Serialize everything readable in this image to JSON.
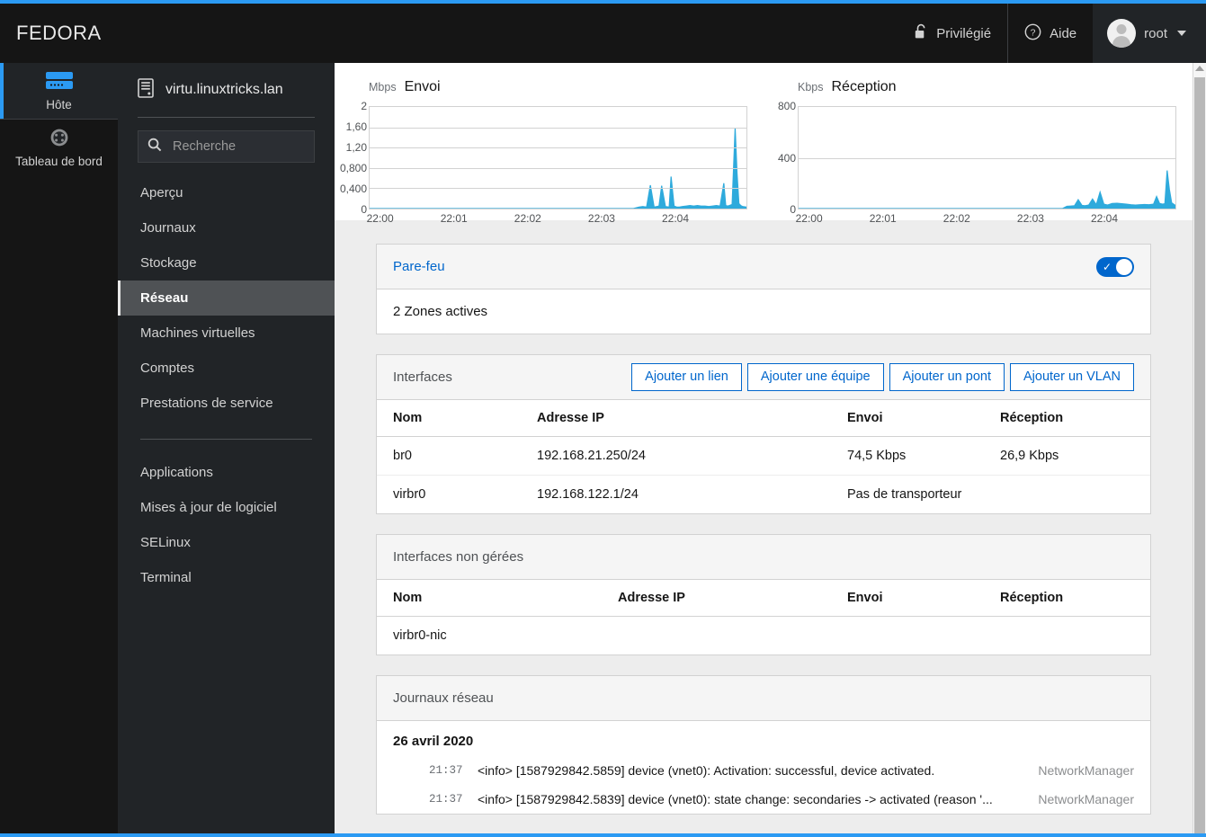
{
  "header": {
    "brand": "FEDORA",
    "privileged_label": "Privilégié",
    "privileged_icon": "unlock-icon",
    "help_label": "Aide",
    "help_icon": "help-circle-icon",
    "user_label": "root",
    "user_icon": "avatar-icon",
    "caret_icon": "chevron-down-icon",
    "accent_color": "#2b9af3"
  },
  "rail": {
    "items": [
      {
        "label": "Hôte",
        "icon": "server-icon",
        "active": true
      },
      {
        "label": "Tableau de bord",
        "icon": "dashboard-gauge-icon",
        "active": false
      }
    ]
  },
  "sidebar": {
    "hostname": "virtu.linuxtricks.lan",
    "hostname_icon": "tower-server-icon",
    "search": {
      "placeholder": "Recherche",
      "value": "",
      "icon": "search-icon"
    },
    "items": [
      {
        "label": "Aperçu",
        "active": false
      },
      {
        "label": "Journaux",
        "active": false
      },
      {
        "label": "Stockage",
        "active": false
      },
      {
        "label": "Réseau",
        "active": true
      },
      {
        "label": "Machines virtuelles",
        "active": false
      },
      {
        "label": "Comptes",
        "active": false
      },
      {
        "label": "Prestations de service",
        "active": false
      }
    ],
    "items2": [
      {
        "label": "Applications",
        "active": false
      },
      {
        "label": "Mises à jour de logiciel",
        "active": false
      },
      {
        "label": "SELinux",
        "active": false
      },
      {
        "label": "Terminal",
        "active": false
      }
    ]
  },
  "chart_data": [
    {
      "type": "area",
      "title": "Envoi",
      "ylabel": "Mbps",
      "xlabel": "",
      "unit": "Mbps",
      "ylim": [
        0,
        2
      ],
      "yticks": [
        "0",
        "0,400",
        "0,800",
        "1,20",
        "1,60",
        "2"
      ],
      "ytick_values": [
        0,
        0.4,
        0.8,
        1.2,
        1.6,
        2
      ],
      "xticks": [
        "22:00",
        "22:01",
        "22:02",
        "22:03",
        "22:04"
      ],
      "grid": true,
      "legend": "none",
      "color": "#2eaadc",
      "x": [
        0.0,
        0.7,
        0.715,
        0.725,
        0.735,
        0.745,
        0.755,
        0.762,
        0.768,
        0.775,
        0.785,
        0.795,
        0.8,
        0.808,
        0.815,
        0.822,
        0.83,
        0.84,
        0.85,
        0.86,
        0.87,
        0.88,
        0.89,
        0.9,
        0.91,
        0.92,
        0.93,
        0.94,
        0.945,
        0.95,
        0.955,
        0.962,
        0.97,
        0.975,
        0.98,
        0.985,
        0.99,
        1.0
      ],
      "values": [
        0,
        0,
        0.03,
        0.04,
        0.03,
        0.46,
        0.03,
        0.04,
        0.05,
        0.45,
        0.04,
        0.03,
        0.63,
        0.05,
        0.03,
        0.03,
        0.04,
        0.05,
        0.06,
        0.05,
        0.06,
        0.05,
        0.05,
        0.04,
        0.05,
        0.06,
        0.05,
        0.5,
        0.06,
        0.05,
        0.06,
        0.08,
        1.59,
        0.7,
        0.1,
        0.06,
        0.04,
        0.03
      ]
    },
    {
      "type": "area",
      "title": "Réception",
      "ylabel": "Kbps",
      "xlabel": "",
      "unit": "Kbps",
      "ylim": [
        0,
        800
      ],
      "yticks": [
        "0",
        "400",
        "800"
      ],
      "ytick_values": [
        0,
        400,
        800
      ],
      "xticks": [
        "22:00",
        "22:01",
        "22:02",
        "22:03",
        "22:04"
      ],
      "grid": true,
      "legend": "none",
      "color": "#2eaadc",
      "x": [
        0.0,
        0.7,
        0.712,
        0.722,
        0.732,
        0.742,
        0.752,
        0.76,
        0.77,
        0.78,
        0.79,
        0.8,
        0.81,
        0.82,
        0.832,
        0.845,
        0.858,
        0.87,
        0.882,
        0.894,
        0.906,
        0.918,
        0.93,
        0.942,
        0.95,
        0.958,
        0.966,
        0.972,
        0.978,
        0.984,
        0.99,
        1.0
      ],
      "values": [
        0,
        0,
        18,
        20,
        22,
        70,
        25,
        22,
        28,
        75,
        30,
        130,
        35,
        28,
        40,
        42,
        38,
        35,
        30,
        28,
        30,
        32,
        30,
        35,
        95,
        40,
        35,
        38,
        300,
        150,
        45,
        25
      ]
    }
  ],
  "firewall": {
    "title": "Pare-feu",
    "toggle_on": true,
    "toggle_icon": "check-icon",
    "body": "2 Zones actives"
  },
  "interfaces": {
    "title": "Interfaces",
    "buttons": [
      {
        "label": "Ajouter un lien"
      },
      {
        "label": "Ajouter une équipe"
      },
      {
        "label": "Ajouter un pont"
      },
      {
        "label": "Ajouter un VLAN"
      }
    ],
    "columns": [
      "Nom",
      "Adresse IP",
      "Envoi",
      "Réception"
    ],
    "rows": [
      {
        "nom": "br0",
        "ip": "192.168.21.250/24",
        "envoi": "74,5 Kbps",
        "reception": "26,9 Kbps"
      },
      {
        "nom": "virbr0",
        "ip": "192.168.122.1/24",
        "envoi": "Pas de transporteur",
        "reception": ""
      }
    ]
  },
  "unmanaged": {
    "title": "Interfaces non gérées",
    "columns": [
      "Nom",
      "Adresse IP",
      "Envoi",
      "Réception"
    ],
    "rows": [
      {
        "nom": "virbr0-nic",
        "ip": "",
        "envoi": "",
        "reception": ""
      }
    ]
  },
  "logs": {
    "title": "Journaux réseau",
    "date": "26 avril 2020",
    "entries": [
      {
        "time": "21:37",
        "message": "<info> [1587929842.5859] device (vnet0): Activation: successful, device activated.",
        "source": "NetworkManager"
      },
      {
        "time": "21:37",
        "message": "<info> [1587929842.5839] device (vnet0): state change: secondaries -> activated (reason '...",
        "source": "NetworkManager"
      }
    ]
  }
}
